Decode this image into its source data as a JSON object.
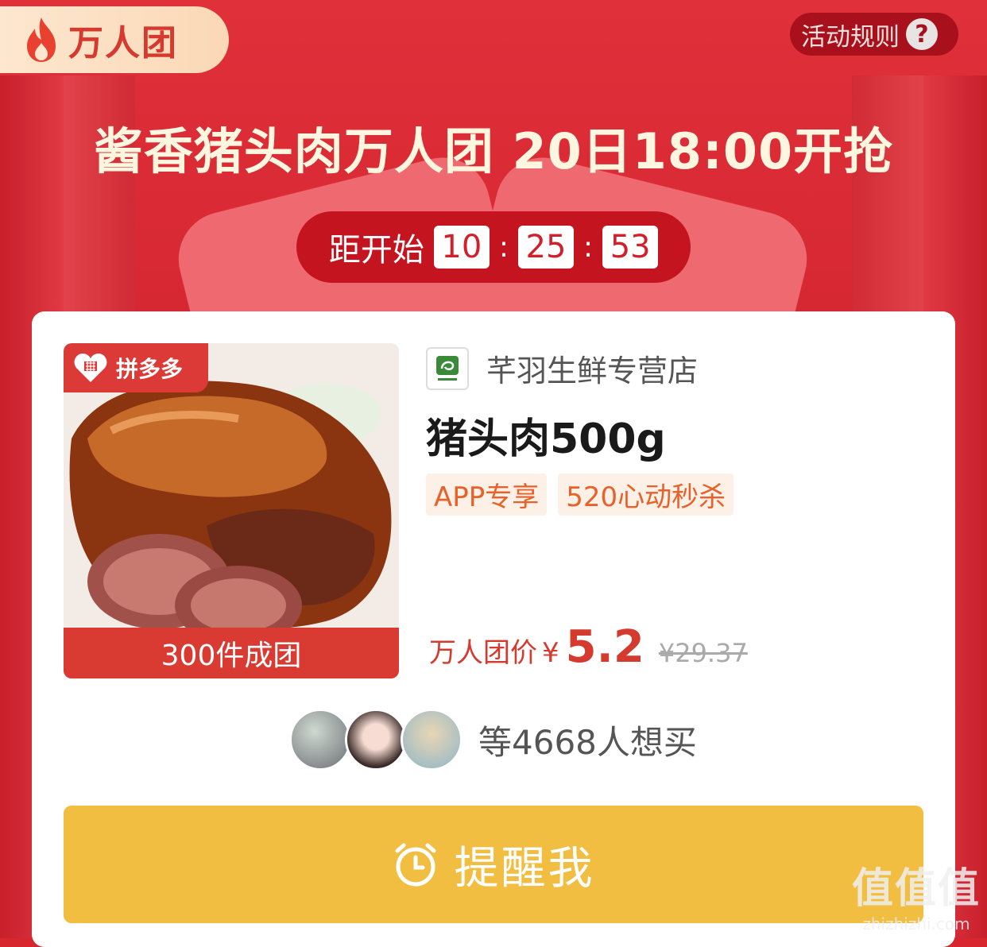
{
  "header": {
    "badge_label": "万人团",
    "rules_label": "活动规则",
    "rules_help": "?"
  },
  "title": "酱香猪头肉万人团 20日18:00开抢",
  "countdown": {
    "label": "距开始",
    "hours": "10",
    "minutes": "25",
    "seconds": "53",
    "separator": ":"
  },
  "product": {
    "platform_badge": "拼多多",
    "group_size": "300件成团",
    "store_name": "芊羽生鲜专营店",
    "name": "猪头肉500g",
    "tags": [
      "APP专享",
      "520心动秒杀"
    ],
    "price_label": "万人团价",
    "currency": "¥",
    "price": "5.2",
    "original_price": "¥29.37"
  },
  "wants": {
    "text": "等4668人想买"
  },
  "remind_button": {
    "label": "提醒我"
  },
  "watermark": {
    "big": "值值值",
    "small": "zhizhizhi.com"
  },
  "colors": {
    "primary_red": "#d7262e",
    "button_yellow": "#f1be41",
    "price_red": "#d43a2e",
    "tag_orange": "#e8602a"
  }
}
